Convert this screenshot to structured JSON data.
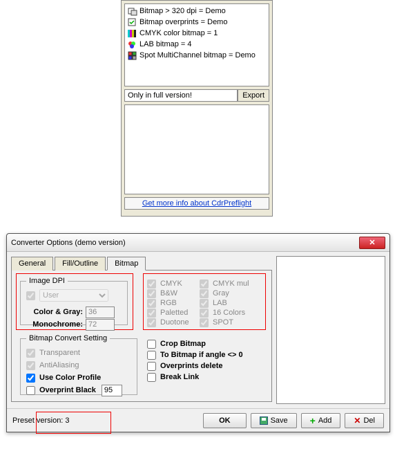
{
  "upper": {
    "items": [
      {
        "icon": "bitmap-resize-icon",
        "text": "Bitmap > 320 dpi = Demo"
      },
      {
        "icon": "bitmap-link-icon",
        "text": "Bitmap overprints = Demo"
      },
      {
        "icon": "cmyk-swatch-icon",
        "text": "CMYK color bitmap = 1"
      },
      {
        "icon": "lab-swatch-icon",
        "text": "LAB bitmap = 4"
      },
      {
        "icon": "multichannel-icon",
        "text": "Spot MultiChannel bitmap = Demo"
      }
    ],
    "only_full_label": "Only in full version!",
    "export_label": "Export",
    "link_text": "Get more info about CdrPreflight",
    "link_href": "#"
  },
  "dialog": {
    "title": "Converter Options (demo version)",
    "tabs": {
      "general": "General",
      "fill": "Fill/Outline",
      "bitmap": "Bitmap"
    },
    "image_dpi": {
      "legend": "Image DPI",
      "user_combo": "User",
      "color_gray_label": "Color & Gray:",
      "color_gray_value": "36",
      "mono_label": "Monochrome:",
      "mono_value": "72"
    },
    "colorspaces": {
      "cmyk": "CMYK",
      "cmyk_mul": "CMYK mul",
      "bw": "B&W",
      "gray": "Gray",
      "rgb": "RGB",
      "lab": "LAB",
      "paletted": "Paletted",
      "colors16": "16 Colors",
      "duotone": "Duotone",
      "spot": "SPOT"
    },
    "convert_setting": {
      "legend": "Bitmap Convert Setting",
      "transparent": "Transparent",
      "antialiasing": "AntiAliasing",
      "use_color_profile": "Use Color Profile",
      "overprint_black": "Overprint Black",
      "overprint_value": "95"
    },
    "right_opts": {
      "crop_bitmap": "Crop Bitmap",
      "angle": "To Bitmap if angle <> 0",
      "overprints_delete": "Overprints delete",
      "break_link": "Break Link"
    },
    "footer": {
      "preset_label": "Preset version: 3",
      "ok": "OK",
      "save": "Save",
      "add": "Add",
      "del": "Del"
    }
  }
}
